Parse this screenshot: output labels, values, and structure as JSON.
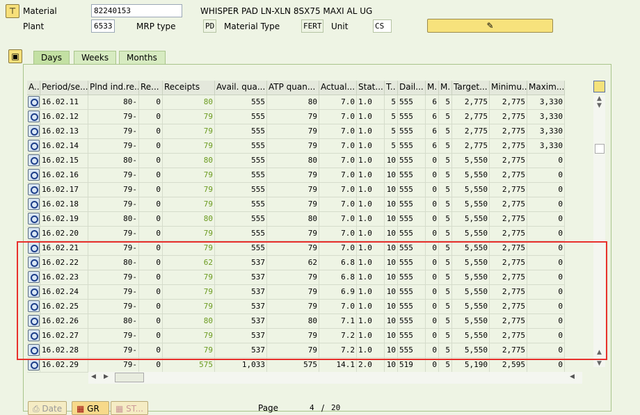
{
  "header": {
    "material_label": "Material",
    "material_value": "82240153",
    "material_desc": "WHISPER PAD LN-XLN 8SX75 MAXI AL UG",
    "plant_label": "Plant",
    "plant_value": "6533",
    "mrp_type_label": "MRP type",
    "mrp_type_value": "PD",
    "material_type_label": "Material Type",
    "material_type_value": "FERT",
    "unit_label": "Unit",
    "unit_value": "CS"
  },
  "tabs": [
    {
      "label": "Days"
    },
    {
      "label": "Weeks"
    },
    {
      "label": "Months"
    }
  ],
  "columns": [
    "A..",
    "Period/se...",
    "Plnd ind.re...",
    "Re...",
    "Receipts",
    "Avail. qua...",
    "ATP quan...",
    "Actual...",
    "Stat...",
    "T..",
    "Dail...",
    "M.",
    "M.",
    "Target...",
    "Minimu...",
    "Maxim..."
  ],
  "rows": [
    [
      "16.02.11",
      "80-",
      "0",
      "80",
      "555",
      "80",
      "7.0",
      "1.0",
      "5",
      "555",
      "6",
      "5",
      "2,775",
      "2,775",
      "3,330"
    ],
    [
      "16.02.12",
      "79-",
      "0",
      "79",
      "555",
      "79",
      "7.0",
      "1.0",
      "5",
      "555",
      "6",
      "5",
      "2,775",
      "2,775",
      "3,330"
    ],
    [
      "16.02.13",
      "79-",
      "0",
      "79",
      "555",
      "79",
      "7.0",
      "1.0",
      "5",
      "555",
      "6",
      "5",
      "2,775",
      "2,775",
      "3,330"
    ],
    [
      "16.02.14",
      "79-",
      "0",
      "79",
      "555",
      "79",
      "7.0",
      "1.0",
      "5",
      "555",
      "6",
      "5",
      "2,775",
      "2,775",
      "3,330"
    ],
    [
      "16.02.15",
      "80-",
      "0",
      "80",
      "555",
      "80",
      "7.0",
      "1.0",
      "10",
      "555",
      "0",
      "5",
      "5,550",
      "2,775",
      "0"
    ],
    [
      "16.02.16",
      "79-",
      "0",
      "79",
      "555",
      "79",
      "7.0",
      "1.0",
      "10",
      "555",
      "0",
      "5",
      "5,550",
      "2,775",
      "0"
    ],
    [
      "16.02.17",
      "79-",
      "0",
      "79",
      "555",
      "79",
      "7.0",
      "1.0",
      "10",
      "555",
      "0",
      "5",
      "5,550",
      "2,775",
      "0"
    ],
    [
      "16.02.18",
      "79-",
      "0",
      "79",
      "555",
      "79",
      "7.0",
      "1.0",
      "10",
      "555",
      "0",
      "5",
      "5,550",
      "2,775",
      "0"
    ],
    [
      "16.02.19",
      "80-",
      "0",
      "80",
      "555",
      "80",
      "7.0",
      "1.0",
      "10",
      "555",
      "0",
      "5",
      "5,550",
      "2,775",
      "0"
    ],
    [
      "16.02.20",
      "79-",
      "0",
      "79",
      "555",
      "79",
      "7.0",
      "1.0",
      "10",
      "555",
      "0",
      "5",
      "5,550",
      "2,775",
      "0"
    ],
    [
      "16.02.21",
      "79-",
      "0",
      "79",
      "555",
      "79",
      "7.0",
      "1.0",
      "10",
      "555",
      "0",
      "5",
      "5,550",
      "2,775",
      "0"
    ],
    [
      "16.02.22",
      "80-",
      "0",
      "62",
      "537",
      "62",
      "6.8",
      "1.0",
      "10",
      "555",
      "0",
      "5",
      "5,550",
      "2,775",
      "0"
    ],
    [
      "16.02.23",
      "79-",
      "0",
      "79",
      "537",
      "79",
      "6.8",
      "1.0",
      "10",
      "555",
      "0",
      "5",
      "5,550",
      "2,775",
      "0"
    ],
    [
      "16.02.24",
      "79-",
      "0",
      "79",
      "537",
      "79",
      "6.9",
      "1.0",
      "10",
      "555",
      "0",
      "5",
      "5,550",
      "2,775",
      "0"
    ],
    [
      "16.02.25",
      "79-",
      "0",
      "79",
      "537",
      "79",
      "7.0",
      "1.0",
      "10",
      "555",
      "0",
      "5",
      "5,550",
      "2,775",
      "0"
    ],
    [
      "16.02.26",
      "80-",
      "0",
      "80",
      "537",
      "80",
      "7.1",
      "1.0",
      "10",
      "555",
      "0",
      "5",
      "5,550",
      "2,775",
      "0"
    ],
    [
      "16.02.27",
      "79-",
      "0",
      "79",
      "537",
      "79",
      "7.2",
      "1.0",
      "10",
      "555",
      "0",
      "5",
      "5,550",
      "2,775",
      "0"
    ],
    [
      "16.02.28",
      "79-",
      "0",
      "79",
      "537",
      "79",
      "7.2",
      "1.0",
      "10",
      "555",
      "0",
      "5",
      "5,550",
      "2,775",
      "0"
    ],
    [
      "16.02.29",
      "79-",
      "0",
      "575",
      "1,033",
      "575",
      "14.1",
      "2.0",
      "10",
      "519",
      "0",
      "5",
      "5,190",
      "2,595",
      "0"
    ]
  ],
  "footer": {
    "date_label": "Date",
    "gr_label": "GR",
    "st_label": "ST...",
    "page_label": "Page",
    "page_current": "4",
    "page_sep": "/",
    "page_total": "20"
  },
  "colors": {
    "highlight_box": "#e8302c",
    "receipts_text": "#6a9a1e"
  }
}
